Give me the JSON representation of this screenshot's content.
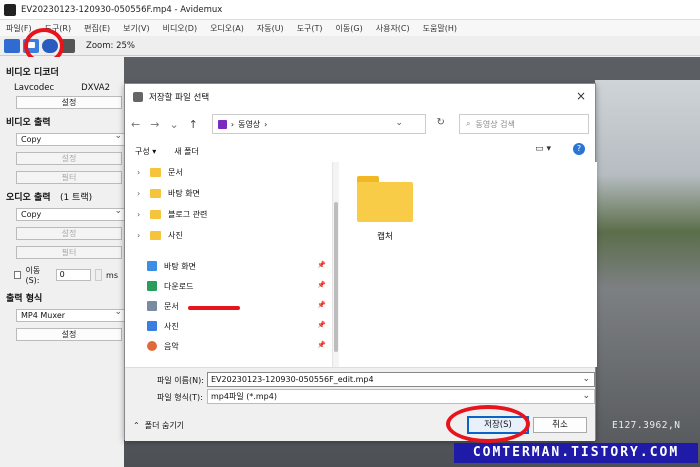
{
  "window": {
    "title": "EV20230123-120930-050556F.mp4 - Avidemux"
  },
  "menu": [
    "파일(F)",
    "도구(R)",
    "편집(E)",
    "보기(V)",
    "비디오(D)",
    "오디오(A)",
    "자동(U)",
    "도구(T)",
    "이동(G)",
    "사용자(C)",
    "도움말(H)"
  ],
  "toolbar": {
    "zoom": "Zoom: 25%"
  },
  "left_panel": {
    "video_decoder_title": "비디오 디코더",
    "decoder_name": "Lavcodec",
    "decoder_value": "DXVA2",
    "decoder_config": "설정",
    "video_output_title": "비디오 출력",
    "video_output_value": "Copy",
    "video_config": "설정",
    "video_filter": "필터",
    "audio_output_title": "오디오 출력",
    "audio_tracks": "(1 트랙)",
    "audio_output_value": "Copy",
    "audio_config": "설정",
    "audio_filter": "필터",
    "shift_label": "이동(S):",
    "shift_value": "0",
    "shift_unit": "ms",
    "format_title": "출력 형식",
    "format_value": "MP4 Muxer",
    "format_config": "설정"
  },
  "dialog": {
    "title": "저장할 파일 선택",
    "close": "×",
    "breadcrumb": "동영상",
    "search_placeholder": "동영상 검색",
    "organize": "구성 ▾",
    "new_folder": "새 폴더",
    "tree": [
      {
        "label": "문서"
      },
      {
        "label": "바탕 화면"
      },
      {
        "label": "블로그 관련"
      },
      {
        "label": "사진"
      }
    ],
    "quick_access": [
      {
        "label": "바탕 화면",
        "icon": "desktop-icon",
        "color": "#3a8ee6"
      },
      {
        "label": "다운로드",
        "icon": "download-icon",
        "color": "#2a9d5a"
      },
      {
        "label": "문서",
        "icon": "document-icon",
        "color": "#7a8aa0"
      },
      {
        "label": "사진",
        "icon": "picture-icon",
        "color": "#3a7fe0"
      },
      {
        "label": "음악",
        "icon": "music-icon",
        "color": "#e06a3a"
      }
    ],
    "folder_item": "캡처",
    "filename_label": "파일 이름(N):",
    "filename_value": "EV20230123-120930-050556F_edit.mp4",
    "filetype_label": "파일 형식(T):",
    "filetype_value": "mp4파일 (*.mp4)",
    "hide_folders": "폴더 숨기기",
    "save_button": "저장(S)",
    "cancel_button": "취소"
  },
  "video_overlay": {
    "gps": "E127.3962,N"
  },
  "watermark": "COMTERMAN.TISTORY.COM",
  "colors": {
    "highlight": "#e8131b",
    "accent": "#0a64c8",
    "watermark_bg": "#1f1ba8"
  }
}
